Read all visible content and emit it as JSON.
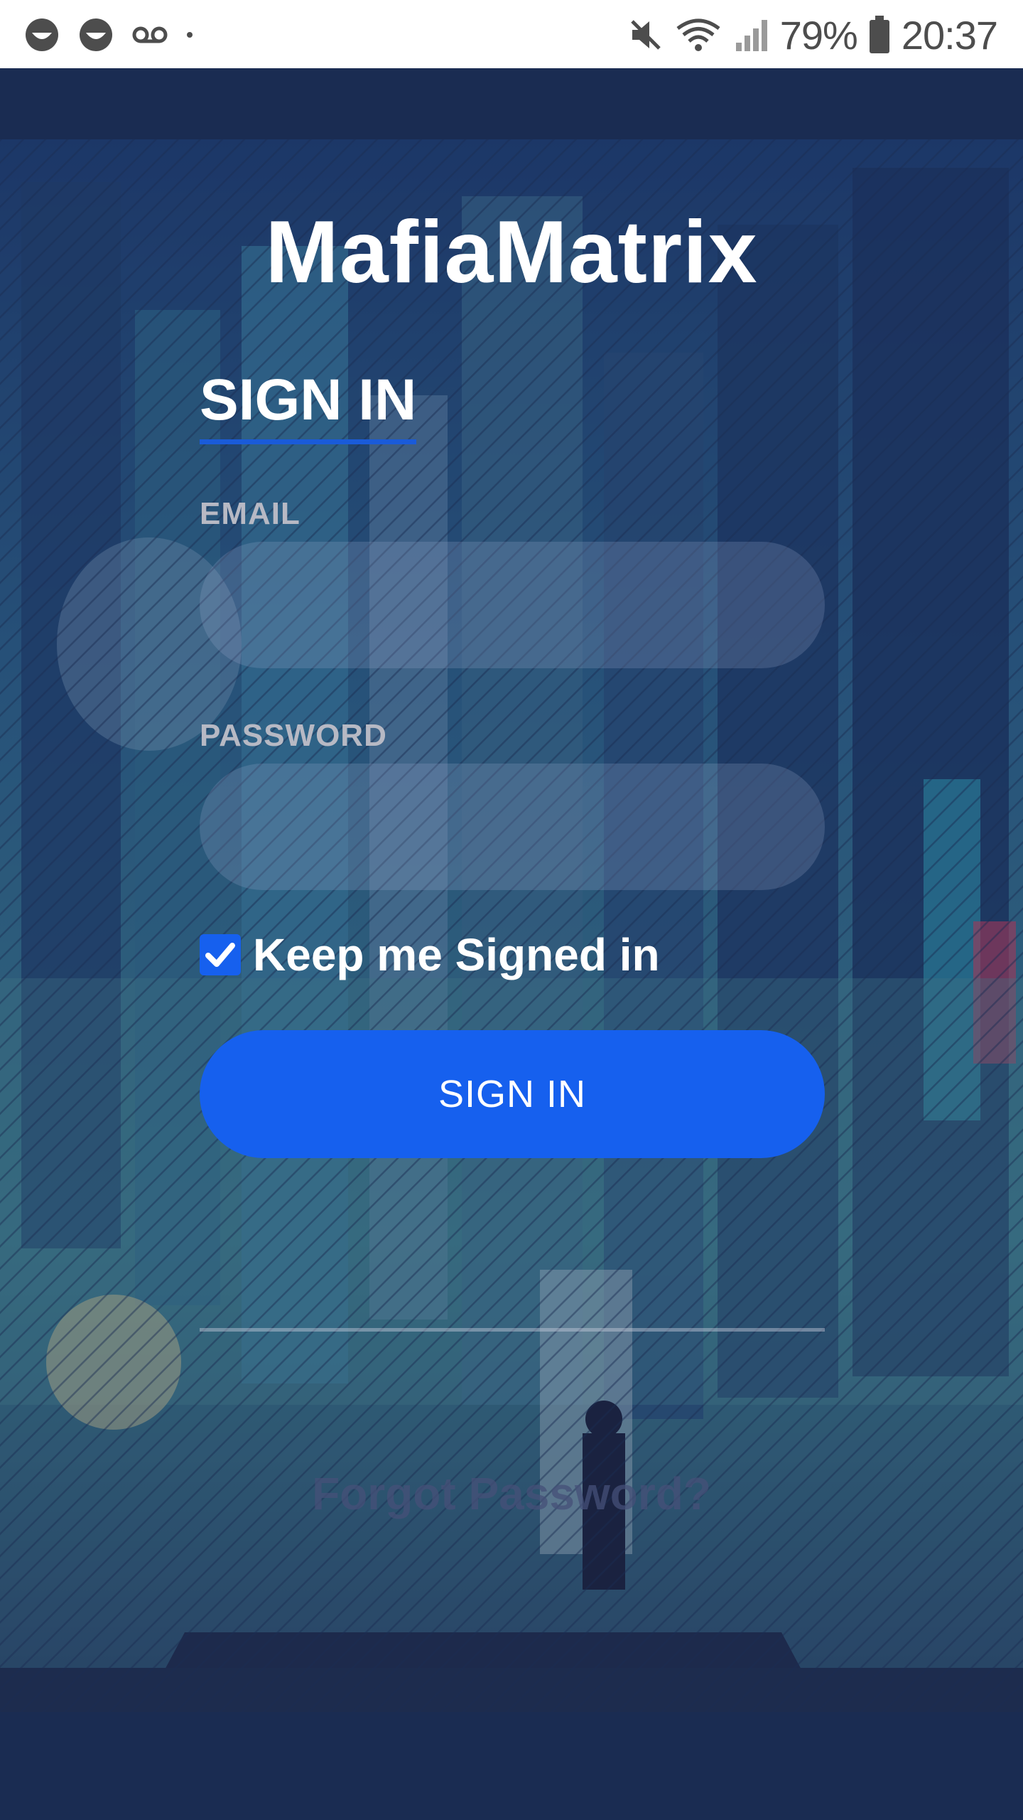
{
  "status_bar": {
    "battery_percent": "79%",
    "time": "20:37",
    "icons": [
      "smiley-face-icon",
      "smiley-face-icon",
      "voicemail-icon",
      "dot-icon",
      "mute-icon",
      "wifi-icon",
      "signal-icon",
      "battery-icon"
    ]
  },
  "app": {
    "title": "MafiaMatrix"
  },
  "form": {
    "tab_label": "SIGN IN",
    "email_label": "EMAIL",
    "email_value": "",
    "password_label": "PASSWORD",
    "password_value": "",
    "keep_signed_in_label": "Keep me Signed in",
    "keep_signed_in_checked": true,
    "submit_label": "SIGN IN",
    "forgot_password_label": "Forgot Password?"
  },
  "colors": {
    "accent": "#1660ee",
    "band": "#1a2c52",
    "label": "#b7b9c4"
  }
}
